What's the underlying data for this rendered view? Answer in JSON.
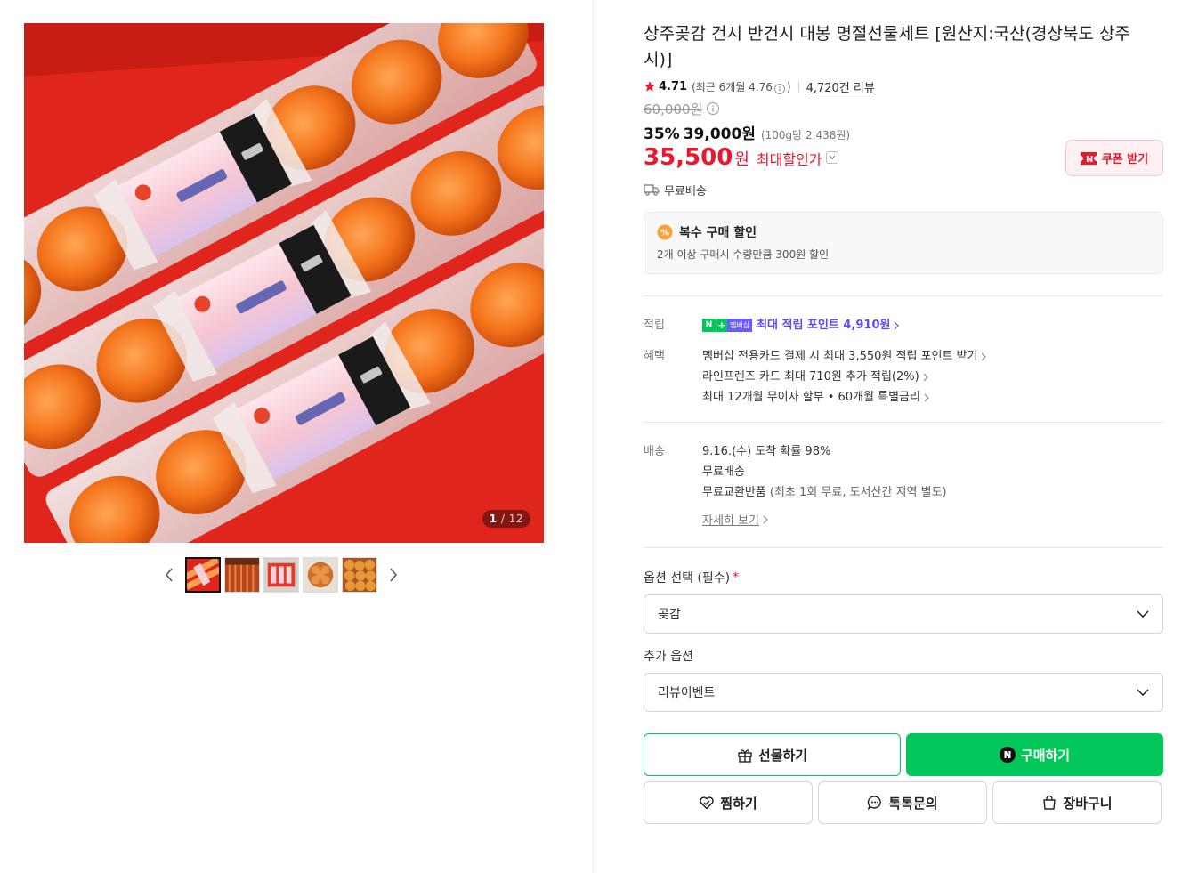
{
  "gallery": {
    "counter_current": "1",
    "counter_total": "/ 12",
    "thumb_count": 5
  },
  "product": {
    "title": "상주곶감 건시 반건시 대봉 명절선물세트 [원산지:국산(경상북도 상주시)]",
    "rating": "4.71",
    "rating_recent": "(최근 6개월 4.76",
    "rating_recent_close": ")",
    "review_count": "4,720건 리뷰",
    "original_price": "60,000원",
    "discount_rate": "35%",
    "discount_price": "39,000원",
    "unit_price": "(100g당 2,438원)",
    "final_price": "35,500",
    "final_unit": "원",
    "final_label": "최대할인가",
    "coupon_label": "쿠폰 받기",
    "shipping": "무료배송"
  },
  "multi_discount": {
    "title": "복수 구매 할인",
    "desc": "2개 이상 구매시 수량만큼 300원 할인"
  },
  "points": {
    "key": "적립",
    "badge_n": "N",
    "badge_plus": "+",
    "badge_mem": "멤버십",
    "text": "최대 적립 포인트 4,910원"
  },
  "benefits": {
    "key": "혜택",
    "items": [
      "멤버십 전용카드 결제 시 최대 3,550원 적립 포인트 받기",
      "라인프렌즈 카드 최대 710원 추가 적립(2%)",
      "최대 12개월 무이자 할부 • 60개월 특별금리"
    ]
  },
  "delivery": {
    "key": "배송",
    "lines": [
      "9.16.(수) 도착 확률 98%",
      "무료배송"
    ],
    "exchange": "무료교환반품",
    "exchange_note": "(최초 1회 무료, 도서산간 지역 별도)",
    "detail_link": "자세히 보기"
  },
  "options": {
    "required_label": "옵션 선택 (필수)",
    "required_star": "*",
    "required_value": "곶감",
    "extra_label": "추가 옵션",
    "extra_value": "리뷰이벤트"
  },
  "actions": {
    "gift": "선물하기",
    "buy": "구매하기",
    "wish": "찜하기",
    "talk": "톡톡문의",
    "cart": "장바구니"
  },
  "colors": {
    "accent_green": "#03c75a",
    "price_red": "#e8182f",
    "point_purple": "#5a4bf5"
  }
}
